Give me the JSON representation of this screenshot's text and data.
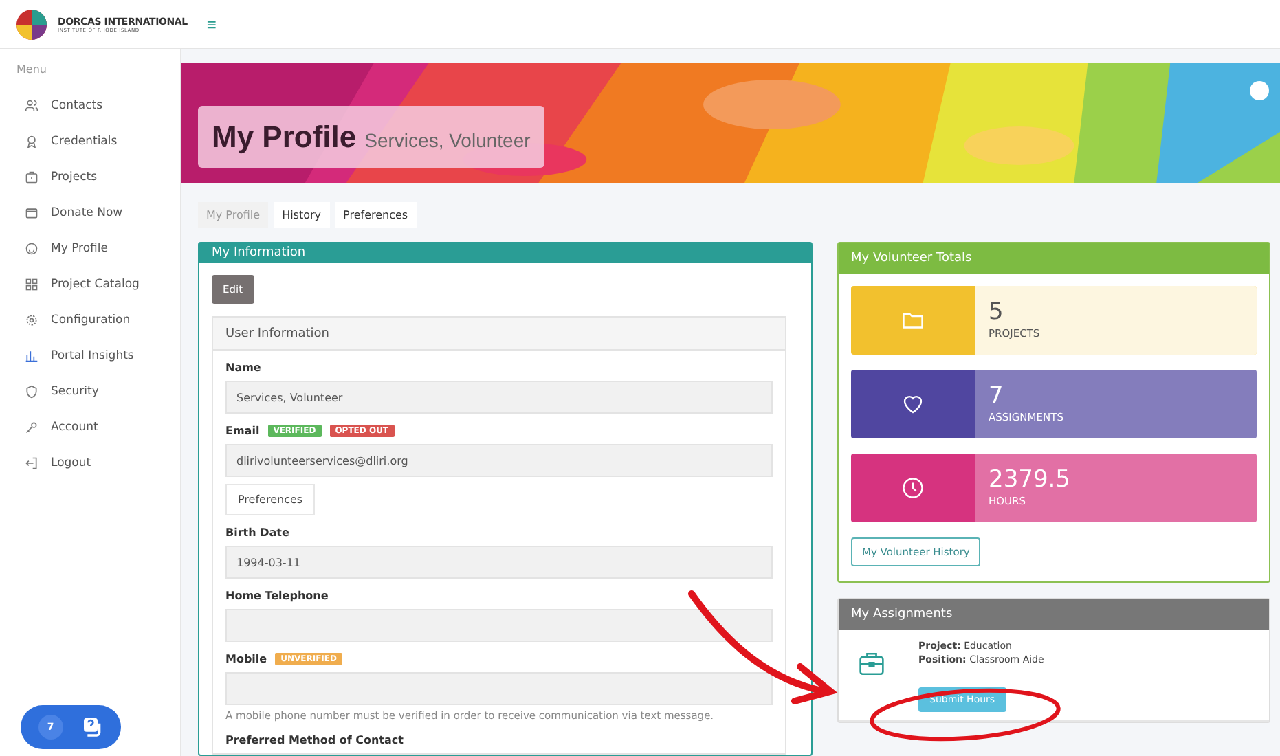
{
  "header": {
    "logo_title": "DORCAS INTERNATIONAL",
    "logo_subtitle": "INSTITUTE OF RHODE ISLAND",
    "menu_toggle": "≡"
  },
  "sidebar": {
    "heading": "Menu",
    "items": [
      {
        "label": "Contacts",
        "kind": "users"
      },
      {
        "label": "Credentials",
        "kind": "badge"
      },
      {
        "label": "Projects",
        "kind": "briefcase"
      },
      {
        "label": "Donate Now",
        "kind": "wallet"
      },
      {
        "label": "My Profile",
        "kind": "smile"
      },
      {
        "label": "Project Catalog",
        "kind": "grid"
      },
      {
        "label": "Configuration",
        "kind": "gear"
      },
      {
        "label": "Portal Insights",
        "kind": "chart"
      },
      {
        "label": "Security",
        "kind": "shield"
      },
      {
        "label": "Account",
        "kind": "key"
      },
      {
        "label": "Logout",
        "kind": "logout"
      }
    ]
  },
  "banner": {
    "title": "My Profile",
    "subtitle": "Services, Volunteer"
  },
  "tabs": [
    {
      "label": "My Profile",
      "selected": true
    },
    {
      "label": "History",
      "selected": false
    },
    {
      "label": "Preferences",
      "selected": false
    }
  ],
  "my_information": {
    "title": "My Information",
    "edit_button": "Edit",
    "section_title": "User Information",
    "fields": [
      {
        "label": "Name",
        "value": "Services, Volunteer"
      },
      {
        "label": "Email",
        "badges": [
          {
            "text": "VERIFIED",
            "color": "#5cb85c"
          },
          {
            "text": "OPTED OUT",
            "color": "#d9534f"
          }
        ],
        "value": "dlirivolunteerservices@dliri.org",
        "button": "Preferences"
      },
      {
        "label": "Birth Date",
        "value": "1994-03-11"
      },
      {
        "label": "Home Telephone"
      },
      {
        "label": "Mobile",
        "badges": [
          {
            "text": "UNVERIFIED",
            "color": "#f0ad4e"
          }
        ],
        "help": "A mobile phone number must be verified in order to receive communication via text message."
      },
      {
        "label": "Preferred Method of Contact",
        "kind": "label_only"
      }
    ]
  },
  "volunteer_totals": {
    "title": "My Volunteer Totals",
    "stats": [
      {
        "value": "5",
        "label": "PROJECTS",
        "kind": "folder",
        "color": "#f2c12e"
      },
      {
        "value": "7",
        "label": "ASSIGNMENTS",
        "kind": "heart",
        "color": "#5046a0"
      },
      {
        "value": "2379.5",
        "label": "HOURS",
        "kind": "clock",
        "color": "#d6337f"
      }
    ],
    "history_button": "My Volunteer History"
  },
  "assignments": {
    "title": "My Assignments",
    "items": [
      {
        "lines": [
          "**Project:** Education",
          "**Position:** Classroom Aide"
        ],
        "button": "Submit Hours"
      }
    ]
  },
  "help_widget": {
    "count": "7"
  }
}
